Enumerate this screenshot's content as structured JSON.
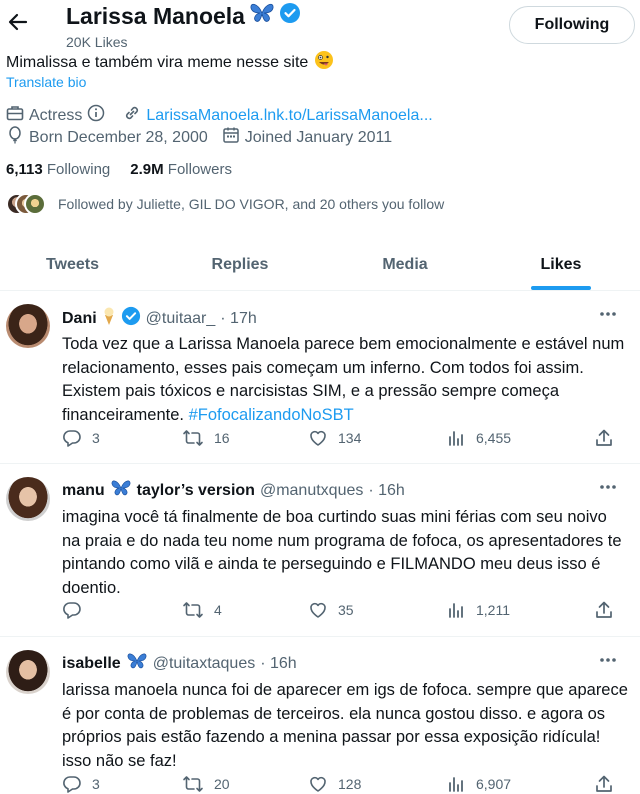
{
  "profile": {
    "name": "Larissa Manoela",
    "likes_count": "20K Likes",
    "follow_button": "Following",
    "bio": "Mimalissa e também vira meme nesse site",
    "translate": "Translate bio",
    "category": "Actress",
    "link": "LarissaManoela.lnk.to/LarissaManoela...",
    "born": "Born December 28, 2000",
    "joined": "Joined January 2011",
    "following_count": "6,113",
    "following_label": "Following",
    "followers_count": "2.9M",
    "followers_label": "Followers",
    "followed_by": "Followed by Juliette, GIL DO VIGOR, and 20 others you follow"
  },
  "tabs": [
    {
      "label": "Tweets"
    },
    {
      "label": "Replies"
    },
    {
      "label": "Media"
    },
    {
      "label": "Likes",
      "active": true
    }
  ],
  "tweets": [
    {
      "name": "Dani",
      "handle": "@tuitaar_",
      "time": "· 17h",
      "text": "Toda vez que a Larissa Manoela parece bem emocionalmente e estável num relacionamento, esses pais começam um inferno. Com todos foi assim. Existem pais tóxicos e narcisistas SIM, e a pressão sempre começa financeiramente.",
      "hashtag": "#FofocalizandoNoSBT",
      "replies": "3",
      "retweets": "16",
      "likes": "134",
      "views": "6,455"
    },
    {
      "name": "manu",
      "name_suffix": "taylor’s version",
      "handle": "@manutxques",
      "time": "· 16h",
      "text": "imagina você tá finalmente de boa curtindo suas mini férias com seu noivo na praia e do nada teu nome num programa de fofoca, os apresentadores te pintando como vilã e ainda te perseguindo e FILMANDO meu deus isso é doentio.",
      "replies": "",
      "retweets": "4",
      "likes": "35",
      "views": "1,211"
    },
    {
      "name": "isabelle",
      "handle": "@tuitaxtaques",
      "time": "· 16h",
      "text": "larissa manoela nunca foi de aparecer em igs de fofoca. sempre que aparece é por conta de problemas de terceiros. ela nunca gostou disso. e agora os próprios pais estão fazendo a menina passar por essa exposição ridícula! isso não se faz!",
      "replies": "3",
      "retweets": "20",
      "likes": "128",
      "views": "6,907"
    }
  ],
  "colors": {
    "accent": "#1d9bf0",
    "secondary_text": "#536471",
    "primary_text": "#0f1419",
    "verified": "#1d9bf0",
    "butterfly": "#3b7ed6"
  },
  "icons": [
    "back-arrow-icon",
    "butterfly-emoji-icon",
    "verified-badge-icon",
    "zany-face-emoji-icon",
    "briefcase-icon",
    "info-icon",
    "link-icon",
    "balloon-icon",
    "calendar-icon",
    "ice-cream-emoji-icon",
    "more-icon",
    "reply-icon",
    "retweet-icon",
    "like-icon",
    "views-icon",
    "share-icon"
  ]
}
